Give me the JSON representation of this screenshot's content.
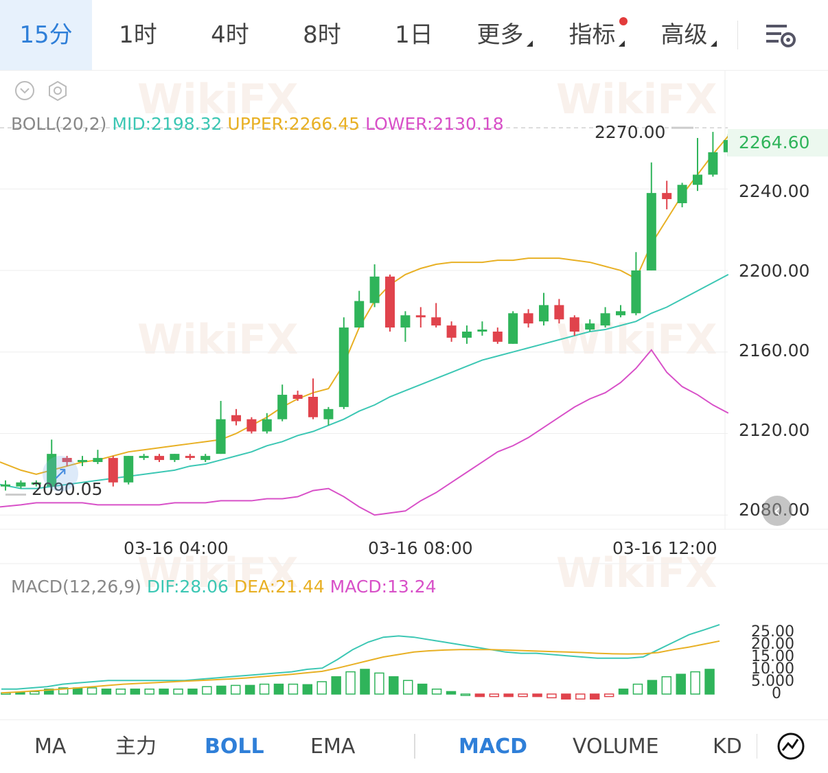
{
  "tabs": {
    "items": [
      {
        "label": "15分"
      },
      {
        "label": "1时"
      },
      {
        "label": "4时"
      },
      {
        "label": "8时"
      },
      {
        "label": "1日"
      },
      {
        "label": "更多"
      },
      {
        "label": "指标"
      },
      {
        "label": "高级"
      }
    ],
    "active": "15分"
  },
  "boll_legend": {
    "name": "BOLL(20,2)",
    "mid": "MID:2198.32",
    "upper": "UPPER:2266.45",
    "lower": "LOWER:2130.18"
  },
  "price_axis": {
    "labels": [
      "2240.00",
      "2200.00",
      "2160.00",
      "2120.00",
      "2080.00"
    ],
    "current": "2264.60",
    "high_marker": "2270.00",
    "low_marker": "2090.05"
  },
  "time_axis": [
    "03-16 04:00",
    "03-16 08:00",
    "03-16 12:00"
  ],
  "macd_legend": {
    "name": "MACD(12,26,9)",
    "dif": "DIF:28.06",
    "dea": "DEA:21.44",
    "macd": "MACD:13.24"
  },
  "macd_axis": [
    "25.00",
    "20.00",
    "15.00",
    "10.00",
    "5.000",
    "0"
  ],
  "bottom_tabs": {
    "left": [
      "MA",
      "主力",
      "BOLL",
      "EMA"
    ],
    "right": [
      "MACD",
      "VOLUME",
      "KD"
    ],
    "active_main": "BOLL",
    "active_sub": "MACD"
  },
  "watermark": "WikiFX",
  "colors": {
    "accent": "#2f7fd8",
    "up": "#2fb45a",
    "down": "#e0434c",
    "mid": "#3cc7b4",
    "upper": "#e8b024",
    "lower": "#d850c8"
  },
  "chart_data": {
    "type": "candlestick",
    "candles": [
      [
        2094,
        2095,
        2092,
        2097
      ],
      [
        2094,
        2096,
        2093,
        2097
      ],
      [
        2095,
        2096,
        2094,
        2097
      ],
      [
        2094,
        2110,
        2092,
        2117
      ],
      [
        2108,
        2106,
        2104,
        2109
      ],
      [
        2106,
        2107,
        2104,
        2109
      ],
      [
        2106,
        2108,
        2105,
        2112
      ],
      [
        2108,
        2096,
        2094,
        2109
      ],
      [
        2096,
        2109,
        2095,
        2109
      ],
      [
        2108,
        2109,
        2107,
        2110
      ],
      [
        2109,
        2107,
        2106,
        2110
      ],
      [
        2107,
        2110,
        2106,
        2110
      ],
      [
        2109,
        2108,
        2107,
        2110
      ],
      [
        2107,
        2109,
        2106,
        2110
      ],
      [
        2110,
        2127,
        2110,
        2136
      ],
      [
        2129,
        2126,
        2124,
        2132
      ],
      [
        2127,
        2121,
        2120,
        2128
      ],
      [
        2121,
        2127,
        2120,
        2130
      ],
      [
        2127,
        2139,
        2126,
        2144
      ],
      [
        2139,
        2137,
        2136,
        2141
      ],
      [
        2138,
        2128,
        2127,
        2147
      ],
      [
        2127,
        2132,
        2124,
        2133
      ],
      [
        2133,
        2172,
        2132,
        2177
      ],
      [
        2172,
        2185,
        2172,
        2190
      ],
      [
        2184,
        2197,
        2182,
        2203
      ],
      [
        2197,
        2172,
        2170,
        2198
      ],
      [
        2172,
        2178,
        2165,
        2180
      ],
      [
        2178,
        2177,
        2172,
        2182
      ],
      [
        2177,
        2173,
        2172,
        2184
      ],
      [
        2173,
        2167,
        2165,
        2175
      ],
      [
        2167,
        2170,
        2164,
        2173
      ],
      [
        2170,
        2171,
        2168,
        2175
      ],
      [
        2170,
        2165,
        2164,
        2172
      ],
      [
        2164,
        2179,
        2164,
        2180
      ],
      [
        2179,
        2174,
        2172,
        2181
      ],
      [
        2175,
        2183,
        2173,
        2189
      ],
      [
        2183,
        2176,
        2174,
        2186
      ],
      [
        2177,
        2170,
        2168,
        2178
      ],
      [
        2171,
        2174,
        2170,
        2176
      ],
      [
        2173,
        2179,
        2172,
        2182
      ],
      [
        2178,
        2180,
        2177,
        2183
      ],
      [
        2179,
        2200,
        2178,
        2209
      ],
      [
        2200,
        2238,
        2200,
        2253
      ],
      [
        2238,
        2235,
        2230,
        2244
      ],
      [
        2233,
        2242,
        2231,
        2243
      ],
      [
        2242,
        2247,
        2239,
        2265
      ],
      [
        2247,
        2258,
        2246,
        2268
      ],
      [
        2258,
        2264,
        2256,
        2267
      ]
    ],
    "boll_mid": [
      2095,
      2093,
      2093,
      2094,
      2095,
      2096,
      2097,
      2098,
      2099,
      2100,
      2101,
      2102,
      2104,
      2105,
      2107,
      2109,
      2111,
      2114,
      2116,
      2119,
      2121,
      2124,
      2127,
      2131,
      2134,
      2138,
      2141,
      2144,
      2147,
      2150,
      2153,
      2156,
      2158,
      2160,
      2162,
      2164,
      2166,
      2168,
      2170,
      2171,
      2173,
      2175,
      2179,
      2182,
      2186,
      2190,
      2194,
      2198
    ],
    "boll_upper": [
      2106,
      2102,
      2100,
      2102,
      2104,
      2106,
      2107,
      2109,
      2111,
      2112,
      2113,
      2114,
      2115,
      2116,
      2117,
      2120,
      2124,
      2128,
      2133,
      2137,
      2140,
      2142,
      2154,
      2172,
      2185,
      2193,
      2198,
      2201,
      2203,
      2204,
      2204,
      2204,
      2205,
      2205,
      2206,
      2206,
      2206,
      2205,
      2204,
      2202,
      2200,
      2196,
      2213,
      2225,
      2237,
      2247,
      2257,
      2266
    ],
    "boll_lower": [
      2084,
      2085,
      2086,
      2086,
      2086,
      2086,
      2085,
      2085,
      2085,
      2085,
      2085,
      2086,
      2086,
      2086,
      2087,
      2087,
      2087,
      2088,
      2088,
      2089,
      2092,
      2093,
      2089,
      2084,
      2080,
      2081,
      2082,
      2087,
      2091,
      2096,
      2101,
      2106,
      2111,
      2114,
      2118,
      2123,
      2128,
      2133,
      2137,
      2140,
      2145,
      2152,
      2161,
      2150,
      2143,
      2139,
      2134,
      2130
    ],
    "macd_hist": [
      0.5,
      0.8,
      1,
      2,
      2.5,
      2.5,
      2.5,
      2,
      2,
      2,
      2,
      2,
      2,
      2,
      3,
      3.2,
      3.5,
      3.5,
      4,
      4,
      4,
      3.8,
      5,
      7,
      9,
      10,
      8.5,
      7,
      5.5,
      4,
      2,
      1,
      0,
      -1,
      -1,
      -1,
      -1,
      -1,
      -1.5,
      -2,
      -2,
      -2,
      -1,
      2,
      4,
      5.5,
      7,
      8,
      9,
      10
    ],
    "dif": [
      2,
      2,
      2.5,
      3,
      4,
      4.5,
      5,
      5.5,
      5.5,
      5.5,
      5.5,
      5.5,
      5.5,
      6,
      6.5,
      7,
      7.5,
      8,
      8.5,
      9,
      10,
      10.5,
      14,
      18,
      21,
      23,
      23.5,
      23,
      22,
      21,
      20,
      19,
      18,
      17,
      16.5,
      16.5,
      16,
      15.5,
      15,
      14.5,
      14.5,
      14.5,
      15,
      18,
      21,
      24,
      26,
      28.06
    ],
    "dea": [
      0.5,
      0.8,
      1.2,
      1.6,
      2,
      2.5,
      3,
      3.5,
      4,
      4.3,
      4.6,
      4.9,
      5.2,
      5.5,
      5.8,
      6.1,
      6.5,
      7,
      7.5,
      8,
      8.6,
      9.2,
      10.5,
      12,
      13.5,
      15,
      16,
      17,
      17.5,
      17.8,
      18,
      18,
      18,
      17.8,
      17.6,
      17.4,
      17.2,
      17,
      16.8,
      16.5,
      16.3,
      16.2,
      16.3,
      16.8,
      18,
      19,
      20.2,
      21.44
    ],
    "price_axis_range": [
      2073,
      2298
    ],
    "macd_axis_range": [
      0,
      25
    ]
  }
}
